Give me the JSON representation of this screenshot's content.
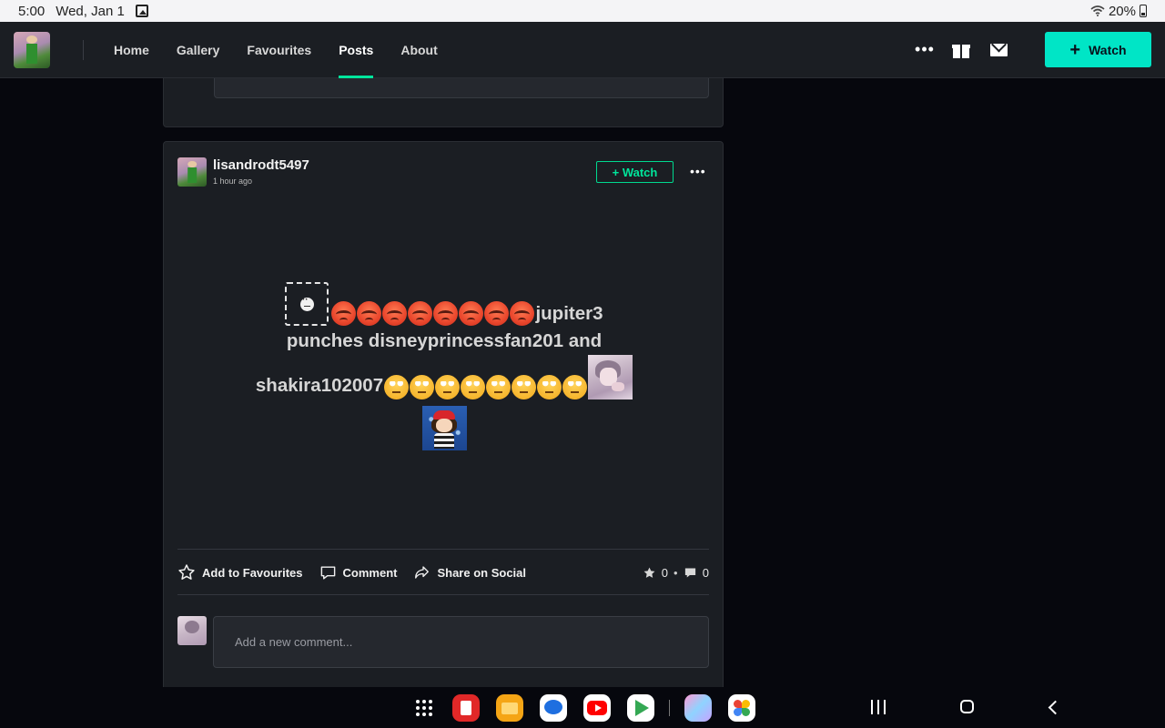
{
  "status_bar": {
    "time": "5:00",
    "date": "Wed, Jan 1",
    "battery": "20%"
  },
  "nav": {
    "links": [
      "Home",
      "Gallery",
      "Favourites",
      "Posts",
      "About"
    ],
    "active": "Posts",
    "watch_label": "Watch",
    "accent_color": "#00e5c6"
  },
  "post": {
    "username": "lisandrodt5497",
    "timestamp": "1 hour ago",
    "watch_label": "+ Watch",
    "body_line1": "jupiter3",
    "body_line2": "punches disneyprincessfan201 and",
    "body_line3": "shakira102007",
    "angry_emoji_count": 8,
    "eye_roll_emoji_count": 8
  },
  "actions": {
    "favourite": "Add to Favourites",
    "comment": "Comment",
    "share": "Share on Social",
    "favourite_count": "0",
    "comment_count": "0"
  },
  "comment_box": {
    "placeholder": "Add a new comment..."
  },
  "dock": {
    "apps": [
      "apps-grid",
      "flipboard",
      "files",
      "messages",
      "youtube",
      "play-store",
      "pony-game",
      "photos"
    ]
  }
}
